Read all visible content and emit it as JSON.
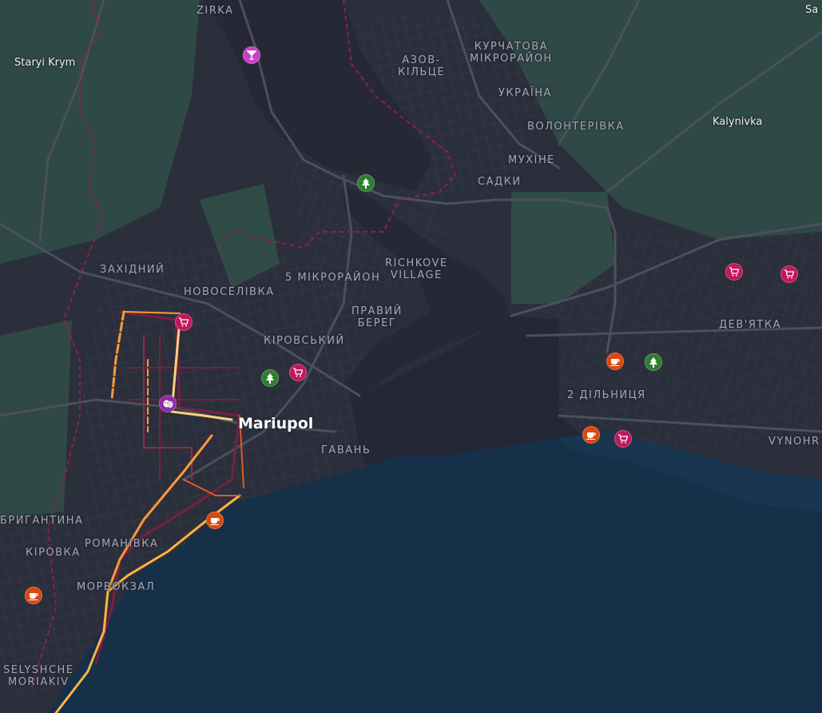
{
  "map": {
    "colors": {
      "land": "#2b2f3b",
      "green": "#2f4d47",
      "water": "#153049",
      "roads": "#4a4f5c",
      "boundary": "#8a2150",
      "route_hot": "#ffb347",
      "route_warm": "#e05a2b",
      "route_dark": "#7a1f3f"
    },
    "labels": {
      "zirka": "ZIRKA",
      "staryi_krym": "Staryi Krym",
      "azov_kiltse_1": "АЗОВ-",
      "azov_kiltse_2": "КІЛЬЦЕ",
      "kurchatova_1": "КУРЧАТОВА",
      "kurchatova_2": "МІКРОРАЙОН",
      "ukraina": "УКРАЇНА",
      "volonterivka": "ВОЛОНТЕРІВКА",
      "kalynivka": "Kalynivka",
      "mukhine": "МУХІНЕ",
      "sadky": "САДКИ",
      "sa": "Sa",
      "zakhidnyi": "ЗАХІДНИЙ",
      "novoselivka": "НОВОСЕЛІВКА",
      "mikroraion5": "5 МІКРОРАЙОН",
      "richkove_1": "RICHKOVE",
      "richkove_2": "VILLAGE",
      "pravyi_1": "ПРАВИЙ",
      "pravyi_2": "БЕРЕГ",
      "kirovskyi": "КІРОВСЬКИЙ",
      "deviatka": "ДЕВ'ЯТКА",
      "dilnytsia": "2 ДІЛЬНИЦЯ",
      "mariupol": "Mariupol",
      "havan": "ГАВАНЬ",
      "vynohr": "VYNOHR",
      "bryhantyna": "БРИГАНТИНА",
      "kirovka": "КІРОВКА",
      "romanivka": "РОМАНІВКА",
      "morvokzal": "МОРВОКЗАЛ",
      "selyshche_1": "SELYSHCHE",
      "selyshche_2": "MORIAKIV"
    },
    "poi_icons": {
      "shop": "shopping-cart-icon",
      "cafe": "coffee-cup-icon",
      "park": "tree-icon",
      "bar": "cocktail-icon",
      "theatre": "theatre-masks-icon"
    }
  }
}
